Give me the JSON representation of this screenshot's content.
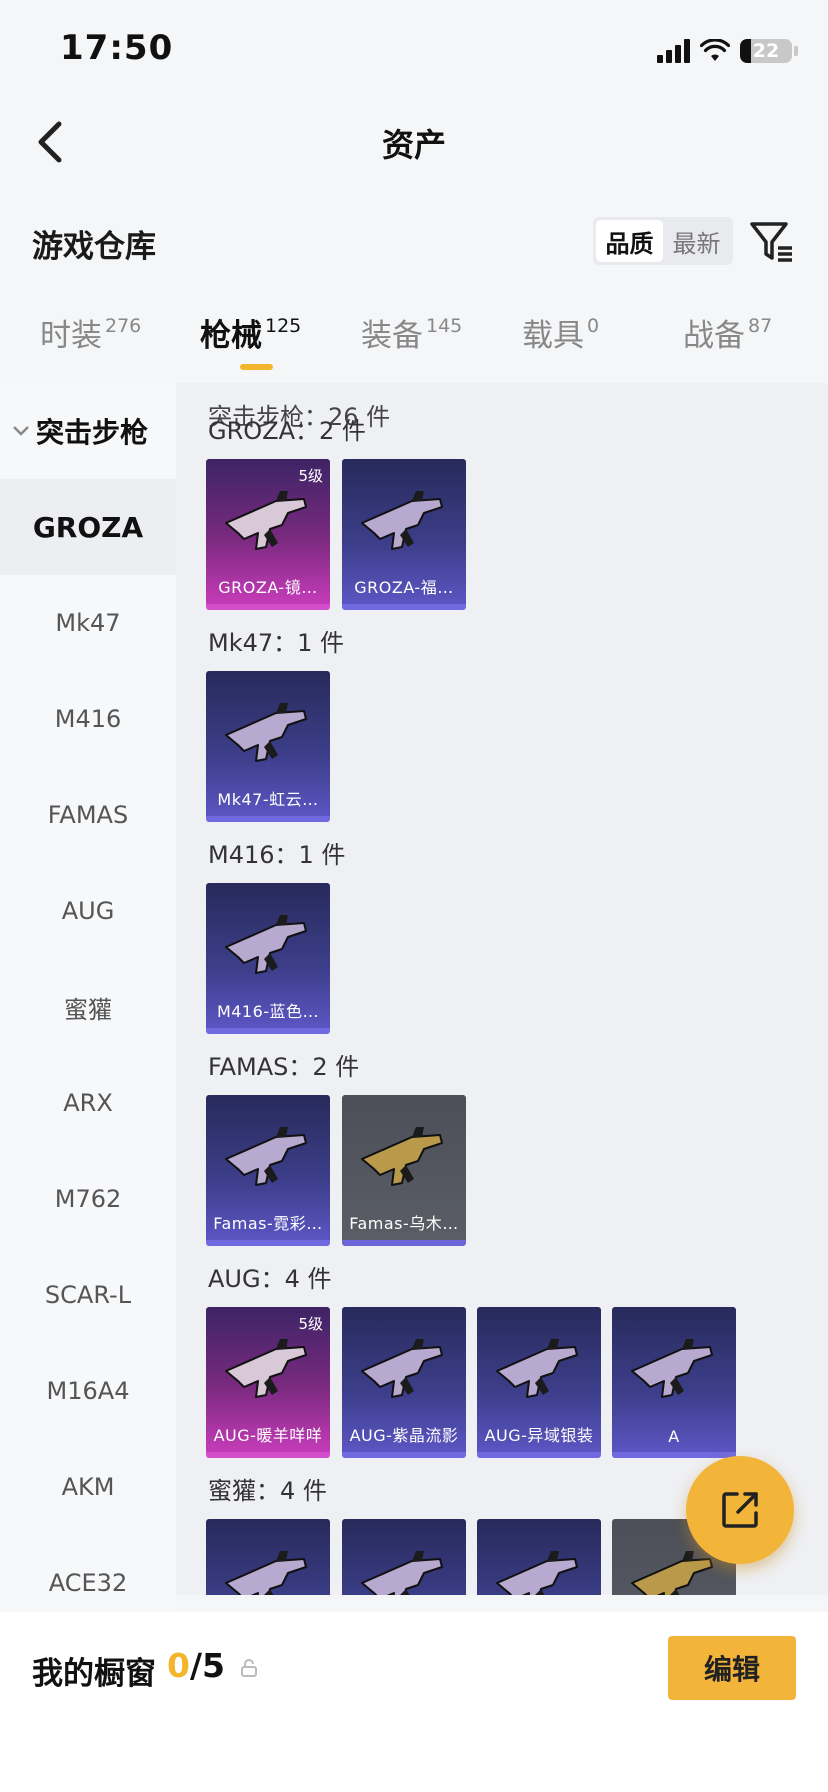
{
  "status_bar": {
    "time": "17:50",
    "battery": "22",
    "battery_level_percent": 22
  },
  "nav": {
    "title": "资产"
  },
  "header": {
    "title": "游戏仓库",
    "sort_options": [
      "品质",
      "最新"
    ],
    "sort_selected": "品质"
  },
  "tabs": [
    {
      "label": "时装",
      "count": "276"
    },
    {
      "label": "枪械",
      "count": "125",
      "active": true
    },
    {
      "label": "装备",
      "count": "145"
    },
    {
      "label": "载具",
      "count": "0"
    },
    {
      "label": "战备",
      "count": "87"
    }
  ],
  "sidebar": {
    "group": "突击步枪",
    "items": [
      "GROZA",
      "Mk47",
      "M416",
      "FAMAS",
      "AUG",
      "蜜獾",
      "ARX",
      "M762",
      "SCAR-L",
      "M16A4",
      "AKM",
      "ACE32"
    ],
    "selected": "GROZA"
  },
  "content": {
    "total": "突击步枪：26 件",
    "groups": [
      {
        "title": "GROZA：2 件",
        "items": [
          {
            "label": "GROZA-镜…",
            "rarity": "pink",
            "badge": "5级"
          },
          {
            "label": "GROZA-福…",
            "rarity": "purple"
          }
        ]
      },
      {
        "title": "Mk47：1 件",
        "items": [
          {
            "label": "Mk47-虹云…",
            "rarity": "purple"
          }
        ]
      },
      {
        "title": "M416：1 件",
        "items": [
          {
            "label": "M416-蓝色…",
            "rarity": "purple"
          }
        ]
      },
      {
        "title": "FAMAS：2 件",
        "items": [
          {
            "label": "Famas-霓彩…",
            "rarity": "purple"
          },
          {
            "label": "Famas-乌木…",
            "rarity": "gray"
          }
        ]
      },
      {
        "title": "AUG：4 件",
        "items": [
          {
            "label": "AUG-暖羊咩咩",
            "rarity": "pink",
            "badge": "5级"
          },
          {
            "label": "AUG-紫晶流影",
            "rarity": "purple"
          },
          {
            "label": "AUG-异域银装",
            "rarity": "purple"
          },
          {
            "label": "A",
            "rarity": "purple"
          }
        ]
      },
      {
        "title": "蜜獾：4 件",
        "items": [
          {
            "label": "",
            "rarity": "purple"
          },
          {
            "label": "",
            "rarity": "purple"
          },
          {
            "label": "",
            "rarity": "purple"
          },
          {
            "label": "",
            "rarity": "gray"
          }
        ]
      }
    ]
  },
  "bottom": {
    "showcase_label": "我的橱窗",
    "showcase_current": "0",
    "showcase_total": "/5",
    "edit_label": "编辑"
  },
  "colors": {
    "accent": "#f3b43a",
    "pink_rarity": "#c53bb8",
    "purple_rarity": "#5b55c2"
  },
  "icons": [
    "back-arrow-icon",
    "filter-icon",
    "chevron-down-icon",
    "share-external-icon",
    "lock-icon"
  ]
}
